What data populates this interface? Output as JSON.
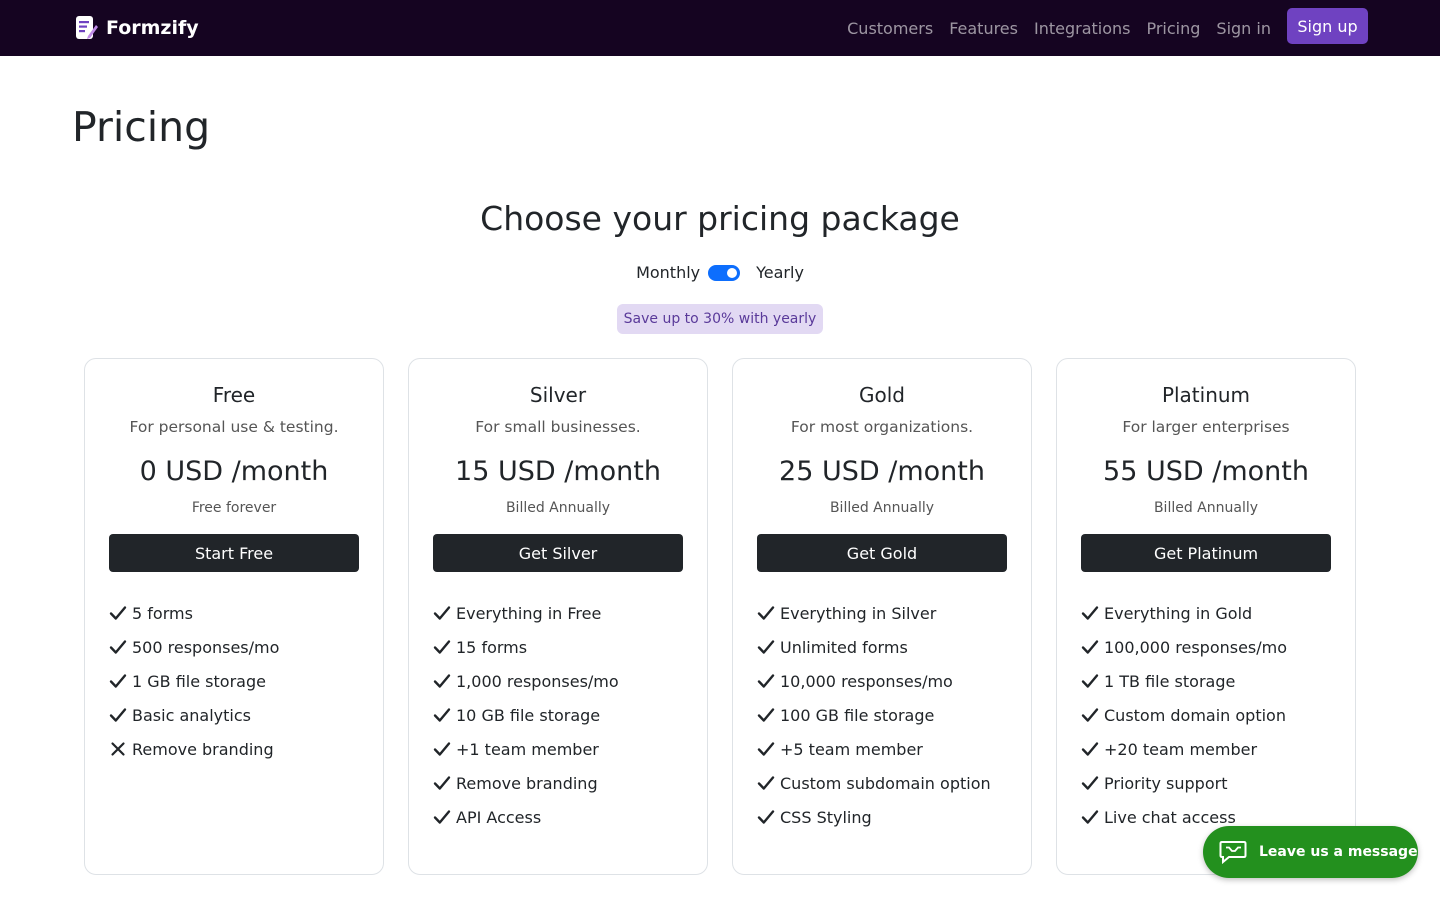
{
  "navbar": {
    "brand": "Formzify",
    "links": [
      "Customers",
      "Features",
      "Integrations",
      "Pricing",
      "Sign in"
    ],
    "signup": "Sign up"
  },
  "page": {
    "title": "Pricing",
    "section_title": "Choose your pricing package"
  },
  "billing": {
    "monthly_label": "Monthly",
    "yearly_label": "Yearly",
    "yearly_selected": true,
    "save_badge": "Save up to 30% with yearly"
  },
  "plans": [
    {
      "name": "Free",
      "description": "For personal use & testing.",
      "price": "0 USD /month",
      "billing": "Free forever",
      "cta": "Start Free",
      "features": [
        {
          "text": "5 forms",
          "included": true
        },
        {
          "text": "500 responses/mo",
          "included": true
        },
        {
          "text": "1 GB file storage",
          "included": true
        },
        {
          "text": "Basic analytics",
          "included": true
        },
        {
          "text": "Remove branding",
          "included": false
        }
      ]
    },
    {
      "name": "Silver",
      "description": "For small businesses.",
      "price": "15 USD /month",
      "billing": "Billed Annually",
      "cta": "Get Silver",
      "features": [
        {
          "text": "Everything in Free",
          "included": true
        },
        {
          "text": "15 forms",
          "included": true
        },
        {
          "text": "1,000 responses/mo",
          "included": true
        },
        {
          "text": "10 GB file storage",
          "included": true
        },
        {
          "text": "+1 team member",
          "included": true
        },
        {
          "text": "Remove branding",
          "included": true
        },
        {
          "text": "API Access",
          "included": true
        }
      ]
    },
    {
      "name": "Gold",
      "description": "For most organizations.",
      "price": "25 USD /month",
      "billing": "Billed Annually",
      "cta": "Get Gold",
      "features": [
        {
          "text": "Everything in Silver",
          "included": true
        },
        {
          "text": "Unlimited forms",
          "included": true
        },
        {
          "text": "10,000 responses/mo",
          "included": true
        },
        {
          "text": "100 GB file storage",
          "included": true
        },
        {
          "text": "+5 team member",
          "included": true
        },
        {
          "text": "Custom subdomain option",
          "included": true
        },
        {
          "text": "CSS Styling",
          "included": true
        }
      ]
    },
    {
      "name": "Platinum",
      "description": "For larger enterprises",
      "price": "55 USD /month",
      "billing": "Billed Annually",
      "cta": "Get Platinum",
      "features": [
        {
          "text": "Everything in Gold",
          "included": true
        },
        {
          "text": "100,000 responses/mo",
          "included": true
        },
        {
          "text": "1 TB file storage",
          "included": true
        },
        {
          "text": "Custom domain option",
          "included": true
        },
        {
          "text": "+20 team member",
          "included": true
        },
        {
          "text": "Priority support",
          "included": true
        },
        {
          "text": "Live chat access",
          "included": true
        }
      ]
    }
  ],
  "chat": {
    "label": "Leave us a message"
  },
  "icons": {
    "brand": "form-document-icon",
    "included": "check-icon",
    "excluded": "x-icon",
    "chat": "chat-bubble-icon"
  },
  "colors": {
    "navbar_bg": "#150421",
    "signup_bg": "#6f42c1",
    "toggle_on": "#0d6efd",
    "badge_bg": "#e2d9f3",
    "cta_bg": "#212529",
    "chat_bg": "#23901e"
  }
}
